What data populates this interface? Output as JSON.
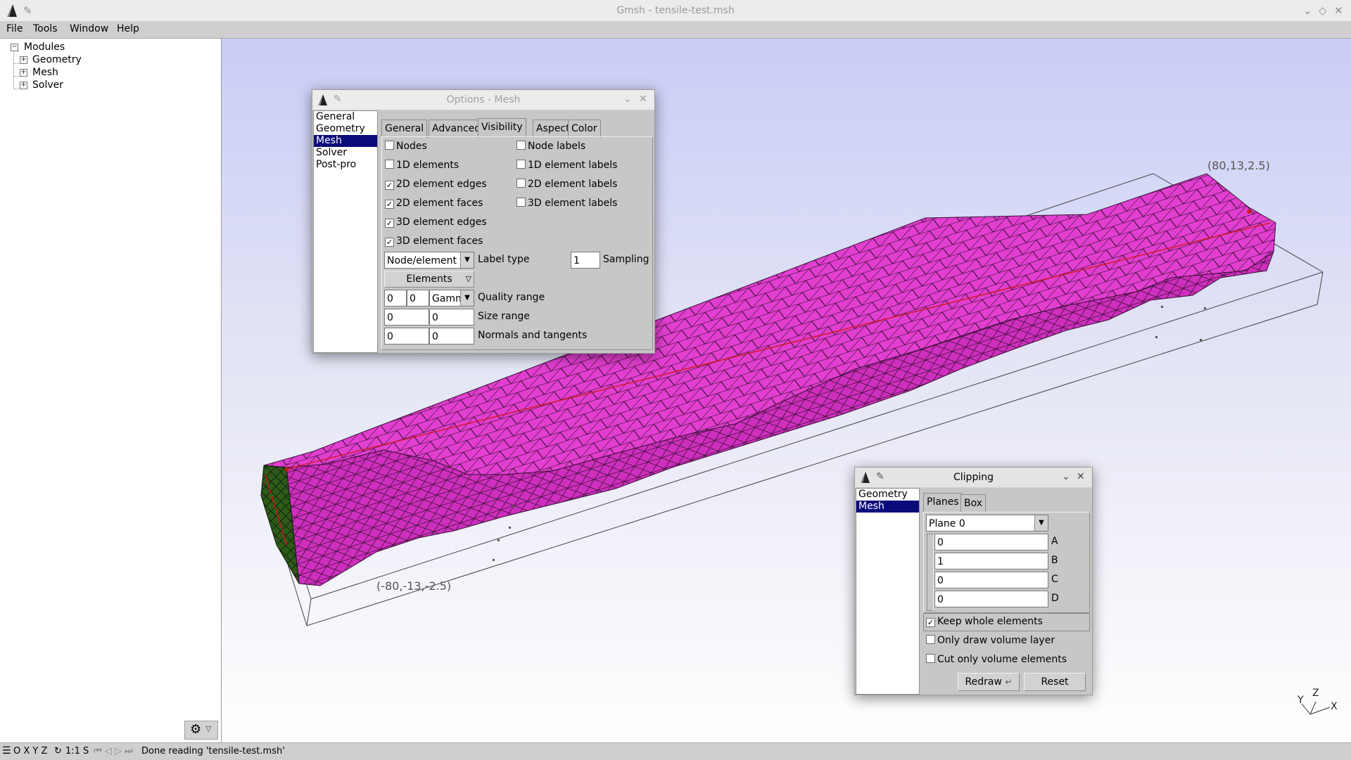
{
  "window": {
    "title": "Gmsh - tensile-test.msh"
  },
  "menu": {
    "file": "File",
    "tools": "Tools",
    "window": "Window",
    "help": "Help"
  },
  "tree": {
    "root": "Modules",
    "items": [
      "Geometry",
      "Mesh",
      "Solver"
    ]
  },
  "viewport": {
    "corner_max": "(80,13,2.5)",
    "corner_min": "(-80,-13,-2.5)",
    "axes": {
      "y": "Y",
      "z": "Z",
      "x": "X"
    },
    "colors": {
      "mesh_face": "#e63cd2",
      "mesh_edge": "#3a1036",
      "cut_face": "#2f5a1c",
      "accent_line": "#d01818"
    }
  },
  "status": {
    "left": "O X Y Z",
    "scale": "1:1 S",
    "message": "Done reading 'tensile-test.msh'"
  },
  "options_dialog": {
    "title": "Options - Mesh",
    "categories": [
      "General",
      "Geometry",
      "Mesh",
      "Solver",
      "Post-pro"
    ],
    "selected_category": "Mesh",
    "tabs": [
      "General",
      "Advanced",
      "Visibility",
      "Aspect",
      "Color"
    ],
    "active_tab": "Visibility",
    "left_checks": [
      {
        "label": "Nodes",
        "checked": false
      },
      {
        "label": "1D elements",
        "checked": false
      },
      {
        "label": "2D element edges",
        "checked": true
      },
      {
        "label": "2D element faces",
        "checked": true
      },
      {
        "label": "3D element edges",
        "checked": true
      },
      {
        "label": "3D element faces",
        "checked": true
      }
    ],
    "right_checks": [
      {
        "label": "Node labels",
        "checked": false
      },
      {
        "label": "1D element labels",
        "checked": false
      },
      {
        "label": "2D element labels",
        "checked": false
      },
      {
        "label": "3D element labels",
        "checked": false
      }
    ],
    "label_type_value": "Node/element ta",
    "label_type_label": "Label type",
    "sampling_value": "1",
    "sampling_label": "Sampling",
    "elements_button": "Elements",
    "quality_min": "0",
    "quality_max": "0",
    "quality_measure": "Gamm",
    "quality_label": "Quality range",
    "size_min": "0",
    "size_max": "0",
    "size_label": "Size range",
    "normals_value": "0",
    "tangents_value": "0",
    "normals_label": "Normals and tangents"
  },
  "clipping_dialog": {
    "title": "Clipping",
    "categories": [
      "Geometry",
      "Mesh"
    ],
    "selected_category": "Mesh",
    "tabs": [
      "Planes",
      "Box"
    ],
    "active_tab": "Planes",
    "plane_select": "Plane 0",
    "coeffs": [
      {
        "label": "A",
        "value": "0"
      },
      {
        "label": "B",
        "value": "1"
      },
      {
        "label": "C",
        "value": "0"
      },
      {
        "label": "D",
        "value": "0"
      }
    ],
    "checks": [
      {
        "label": "Keep whole elements",
        "checked": true
      },
      {
        "label": "Only draw volume layer",
        "checked": false
      },
      {
        "label": "Cut only volume elements",
        "checked": false
      }
    ],
    "redraw_button": "Redraw",
    "reset_button": "Reset"
  }
}
